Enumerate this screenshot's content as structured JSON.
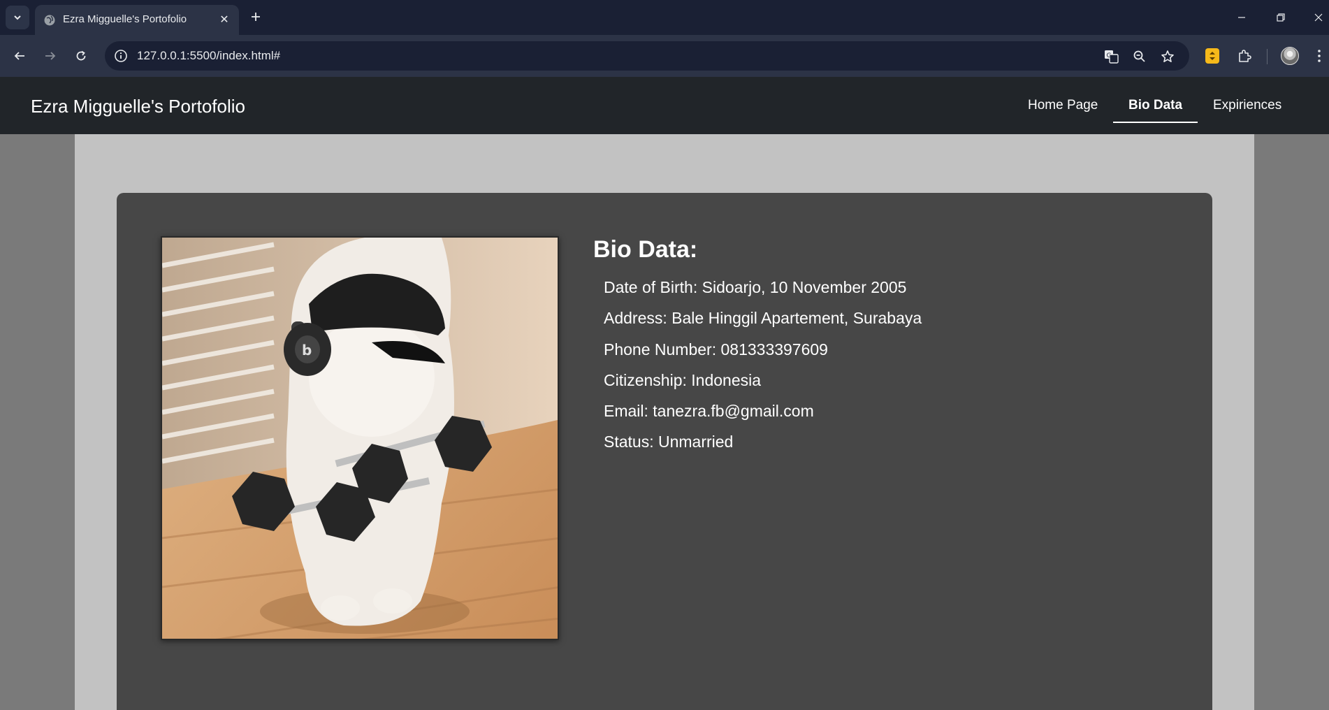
{
  "browser": {
    "tab_title": "Ezra Migguelle's Portofolio",
    "url": "127.0.0.1:5500/index.html#",
    "icons": [
      "tab-search-icon",
      "globe-icon",
      "close-icon",
      "plus-icon",
      "minimize-icon",
      "restore-icon",
      "window-close-icon",
      "back-icon",
      "forward-icon",
      "reload-icon",
      "info-icon",
      "translate-icon",
      "zoom-icon",
      "star-icon",
      "extension-icon",
      "puzzle-icon",
      "profile-avatar",
      "more-icon"
    ]
  },
  "site": {
    "brand": "Ezra Migguelle's Portofolio",
    "nav": [
      {
        "label": "Home Page",
        "active": false
      },
      {
        "label": "Bio Data",
        "active": true
      },
      {
        "label": "Expiriences",
        "active": false
      }
    ]
  },
  "bio": {
    "title": "Bio Data:",
    "items": [
      "Date of Birth: Sidoarjo, 10 November 2005",
      "Address: Bale Hinggil Apartement, Surabaya",
      "Phone Number: 081333397609",
      "Citizenship: Indonesia",
      "Email: tanezra.fb@gmail.com",
      "Status: Unmarried"
    ]
  },
  "photo": {
    "icon": "cat-with-dumbbells-photo"
  },
  "colors": {
    "navbar": "#212529",
    "card": "#474747",
    "container": "#c2c2c2",
    "page_bg": "#7a7a7a"
  }
}
